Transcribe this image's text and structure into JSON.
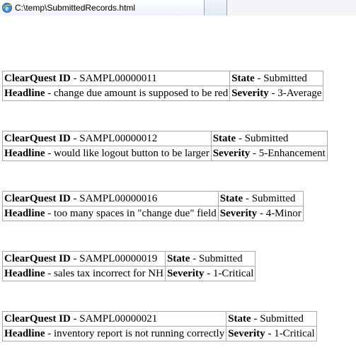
{
  "tab": {
    "icon": "ie-page-icon",
    "title": "C:\\temp\\SubmittedRecords.html"
  },
  "labels": {
    "id": "ClearQuest ID",
    "headline": "Headline",
    "state": "State",
    "severity": "Severity",
    "sep": " - "
  },
  "records": [
    {
      "id": "SAMPL00000011",
      "headline": "change due amount is supposed to be red",
      "state": "Submitted",
      "severity": "3-Average"
    },
    {
      "id": "SAMPL00000012",
      "headline": "would like logout button to be larger",
      "state": "Submitted",
      "severity": "5-Enhancement"
    },
    {
      "id": "SAMPL00000016",
      "headline": "too many spaces in \"change due\" field",
      "state": "Submitted",
      "severity": "4-Minor"
    },
    {
      "id": "SAMPL00000019",
      "headline": "sales tax incorrect for NH",
      "state": "Submitted",
      "severity": "1-Critical"
    },
    {
      "id": "SAMPL00000021",
      "headline": "inventory report is not running correctly",
      "state": "Submitted",
      "severity": "1-Critical"
    }
  ]
}
